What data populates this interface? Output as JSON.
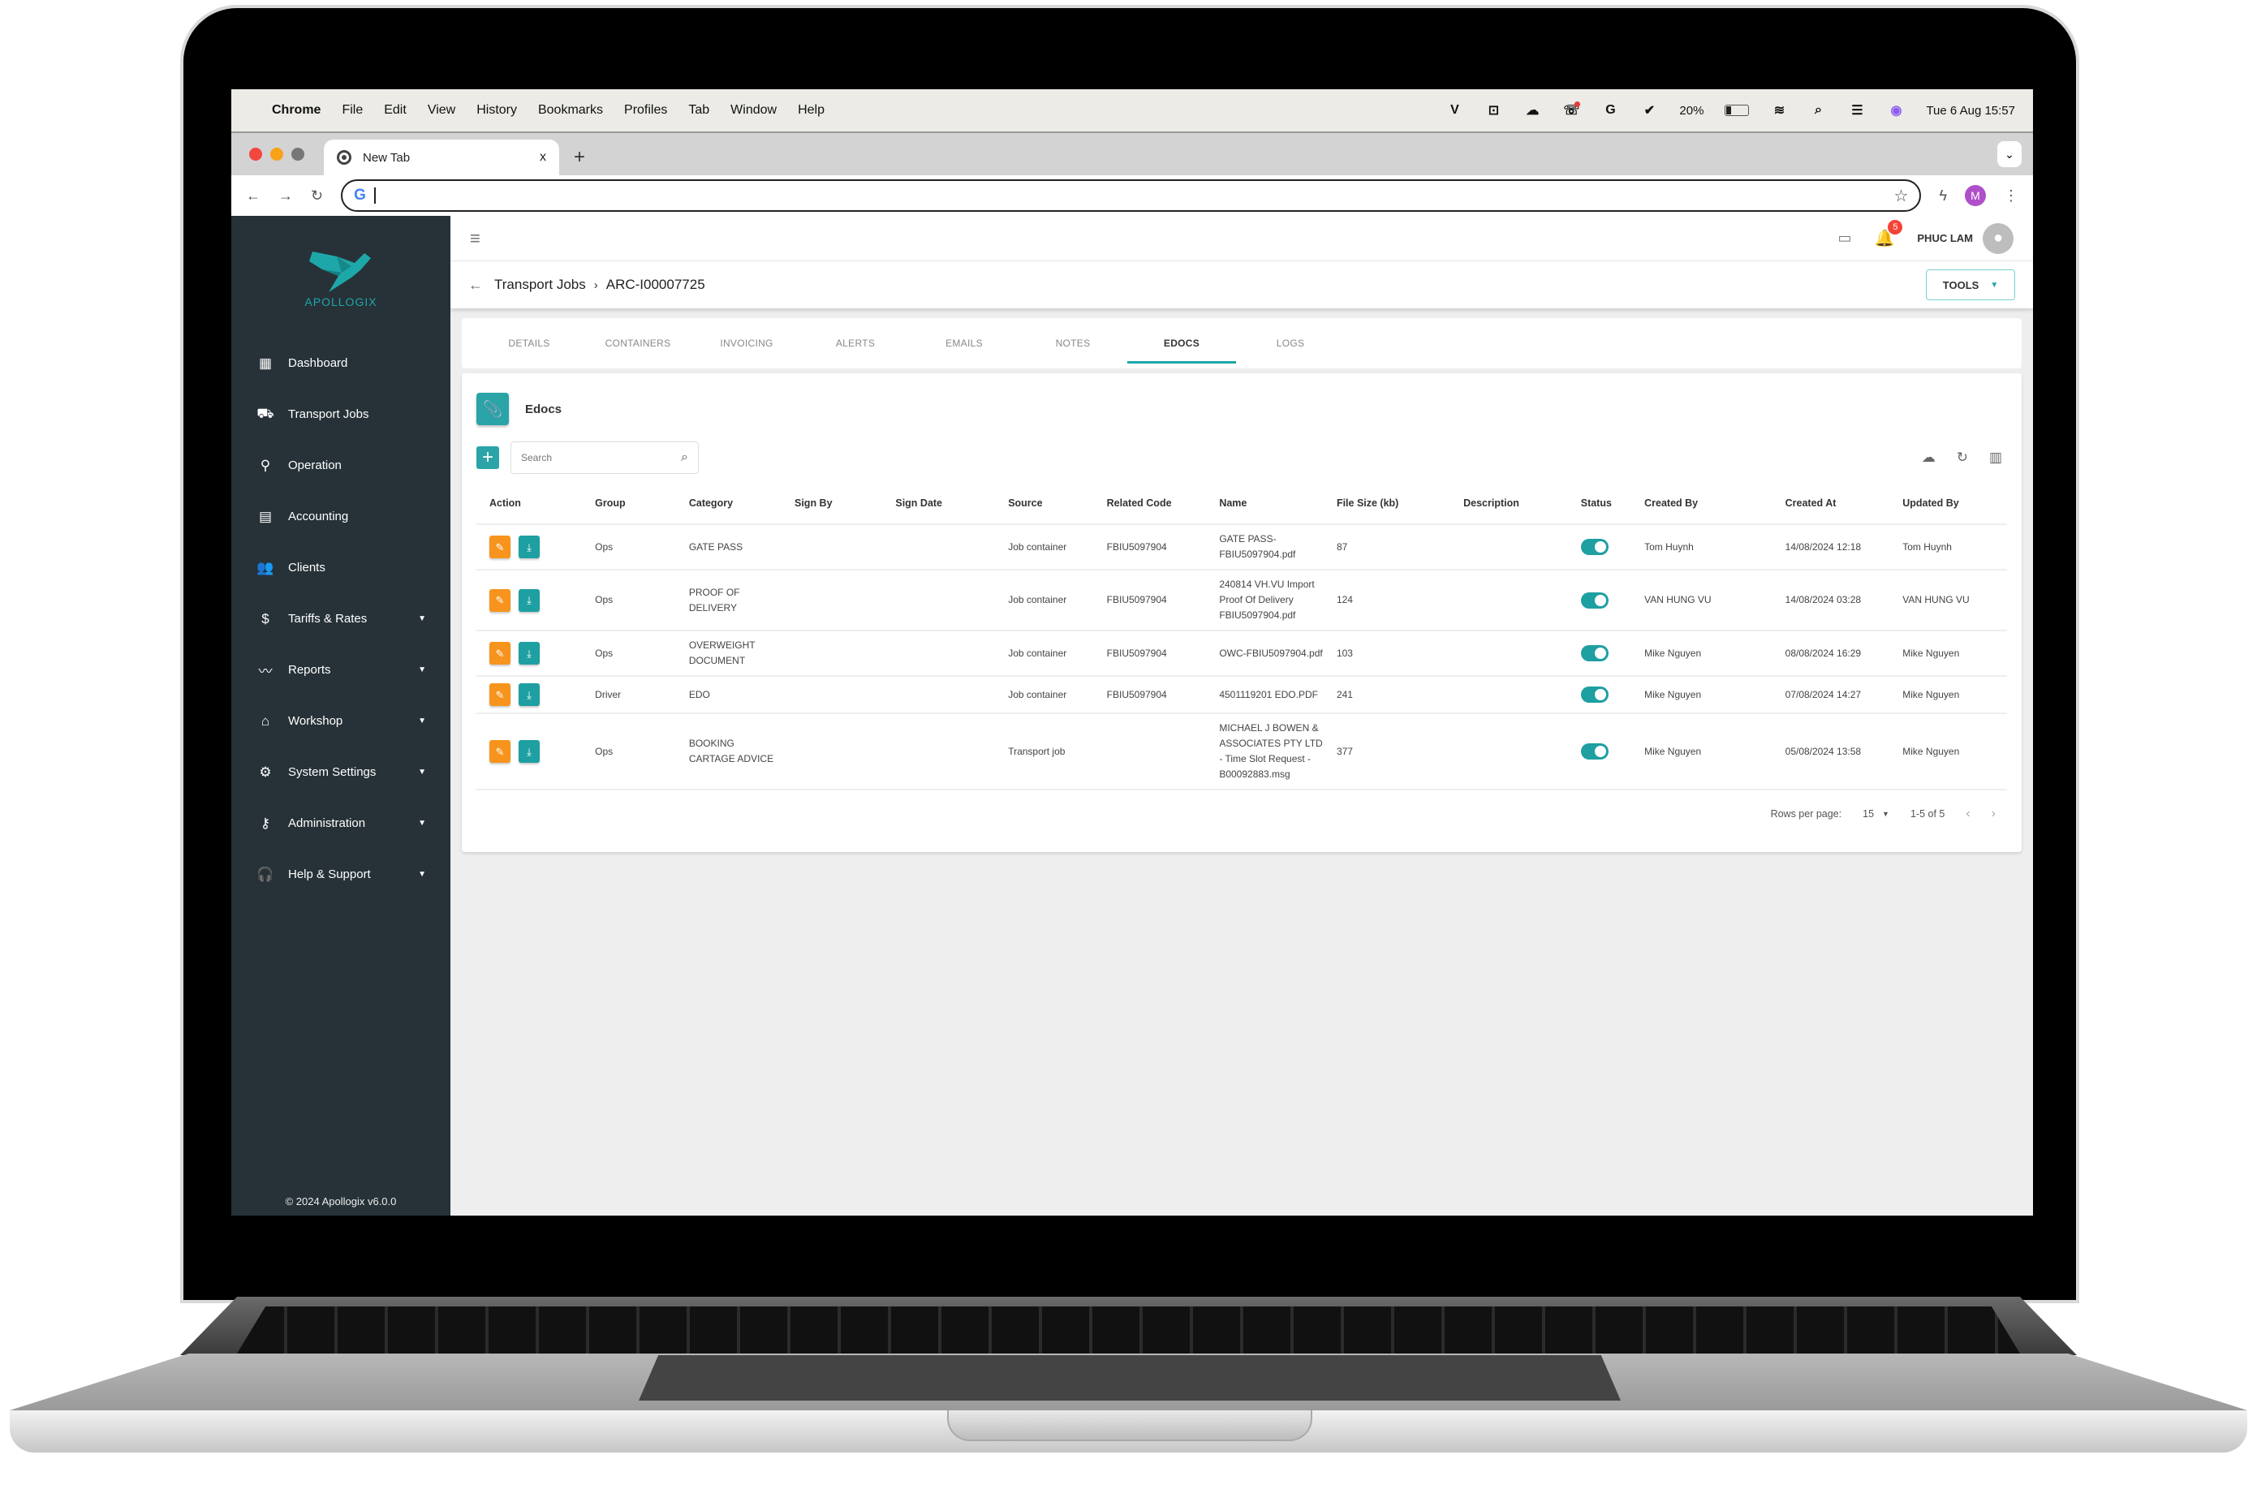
{
  "mac_menubar": {
    "app": "Chrome",
    "items": [
      "File",
      "Edit",
      "View",
      "History",
      "Bookmarks",
      "Profiles",
      "Tab",
      "Window",
      "Help"
    ],
    "status_icons": [
      "v-icon",
      "teamviewer-icon",
      "cloud-sync-icon",
      "phone-notification-icon",
      "grammarly-icon",
      "shield-check-icon"
    ],
    "battery": "20%",
    "datetime": "Tue 6 Aug  15:57"
  },
  "browser": {
    "tab_title": "New Tab",
    "tab_close": "x",
    "new_tab": "+",
    "address": "",
    "profile_initial": "M"
  },
  "sidebar": {
    "brand": "APOLLOGIX",
    "items": [
      {
        "label": "Dashboard",
        "icon": "dashboard-icon",
        "glyph": "▦",
        "expandable": false
      },
      {
        "label": "Transport Jobs",
        "icon": "truck-icon",
        "glyph": "⛟",
        "expandable": false
      },
      {
        "label": "Operation",
        "icon": "location-pin-icon",
        "glyph": "⚲",
        "expandable": false
      },
      {
        "label": "Accounting",
        "icon": "ledger-icon",
        "glyph": "▤",
        "expandable": false
      },
      {
        "label": "Clients",
        "icon": "people-icon",
        "glyph": "👥",
        "expandable": false
      },
      {
        "label": "Tariffs & Rates",
        "icon": "dollar-icon",
        "glyph": "$",
        "expandable": true
      },
      {
        "label": "Reports",
        "icon": "trend-line-icon",
        "glyph": "〰",
        "expandable": true
      },
      {
        "label": "Workshop",
        "icon": "workshop-icon",
        "glyph": "⌂",
        "expandable": true
      },
      {
        "label": "System Settings",
        "icon": "gear-icon",
        "glyph": "⚙",
        "expandable": true
      },
      {
        "label": "Administration",
        "icon": "key-icon",
        "glyph": "⚷",
        "expandable": true
      },
      {
        "label": "Help & Support",
        "icon": "headset-icon",
        "glyph": "🎧",
        "expandable": true
      }
    ],
    "caret": "▼",
    "copyright": "© 2024 Apollogix v6.0.0"
  },
  "topbar": {
    "notification_count": "5",
    "user_name": "PHUC LAM"
  },
  "breadcrumb": {
    "parent": "Transport Jobs",
    "separator": "›",
    "current": "ARC-I00007725"
  },
  "tools_button": "TOOLS",
  "tabs": [
    {
      "label": "DETAILS",
      "active": false
    },
    {
      "label": "CONTAINERS",
      "active": false
    },
    {
      "label": "INVOICING",
      "active": false
    },
    {
      "label": "ALERTS",
      "active": false
    },
    {
      "label": "EMAILS",
      "active": false
    },
    {
      "label": "NOTES",
      "active": false
    },
    {
      "label": "EDOCS",
      "active": true
    },
    {
      "label": "LOGS",
      "active": false
    }
  ],
  "edocs": {
    "title": "Edocs",
    "search_placeholder": "Search",
    "columns": [
      "Action",
      "Group",
      "Category",
      "Sign By",
      "Sign Date",
      "Source",
      "Related Code",
      "Name",
      "File Size (kb)",
      "Description",
      "Status",
      "Created By",
      "Created At",
      "Updated By"
    ],
    "rows": [
      {
        "group": "Ops",
        "category": "GATE PASS",
        "sign_by": "",
        "sign_date": "",
        "source": "Job container",
        "related_code": "FBIU5097904",
        "name": "GATE PASS-FBIU5097904.pdf",
        "file_size": "87",
        "description": "",
        "status": true,
        "created_by": "Tom Huynh",
        "created_at": "14/08/2024 12:18",
        "updated_by": "Tom Huynh"
      },
      {
        "group": "Ops",
        "category": "PROOF OF DELIVERY",
        "sign_by": "",
        "sign_date": "",
        "source": "Job container",
        "related_code": "FBIU5097904",
        "name": "240814 VH.VU Import Proof Of Delivery FBIU5097904.pdf",
        "file_size": "124",
        "description": "",
        "status": true,
        "created_by": "VAN HUNG VU",
        "created_at": "14/08/2024 03:28",
        "updated_by": "VAN HUNG VU"
      },
      {
        "group": "Ops",
        "category": "OVERWEIGHT DOCUMENT",
        "sign_by": "",
        "sign_date": "",
        "source": "Job container",
        "related_code": "FBIU5097904",
        "name": "OWC-FBIU5097904.pdf",
        "file_size": "103",
        "description": "",
        "status": true,
        "created_by": "Mike Nguyen",
        "created_at": "08/08/2024 16:29",
        "updated_by": "Mike Nguyen"
      },
      {
        "group": "Driver",
        "category": "EDO",
        "sign_by": "",
        "sign_date": "",
        "source": "Job container",
        "related_code": "FBIU5097904",
        "name": "4501119201 EDO.PDF",
        "file_size": "241",
        "description": "",
        "status": true,
        "created_by": "Mike Nguyen",
        "created_at": "07/08/2024 14:27",
        "updated_by": "Mike Nguyen"
      },
      {
        "group": "Ops",
        "category": "BOOKING CARTAGE ADVICE",
        "sign_by": "",
        "sign_date": "",
        "source": "Transport job",
        "related_code": "",
        "name": "MICHAEL J BOWEN & ASSOCIATES PTY LTD - Time Slot Request - B00092883.msg",
        "file_size": "377",
        "description": "",
        "status": true,
        "created_by": "Mike Nguyen",
        "created_at": "05/08/2024 13:58",
        "updated_by": "Mike Nguyen"
      }
    ],
    "pagination": {
      "rows_per_page_label": "Rows per page:",
      "rows_per_page": "15",
      "range": "1-5 of 5"
    }
  },
  "colors": {
    "accent": "#1e9fa2",
    "edit": "#f7941d",
    "sidebar": "#263238",
    "badge": "#f44336"
  }
}
